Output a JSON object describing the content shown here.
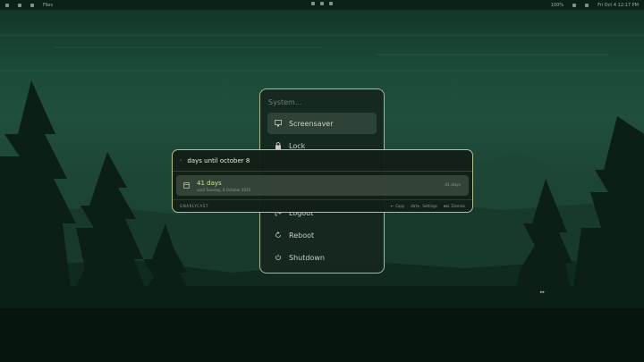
{
  "topbar": {
    "window_label": "Files",
    "clock": "Fri Oct 4  12:17 PM",
    "battery": "100%"
  },
  "system_menu": {
    "search_placeholder": "System...",
    "items": [
      {
        "label": "Screensaver",
        "icon": "monitor-icon",
        "selected": true
      },
      {
        "label": "Lock",
        "icon": "lock-icon",
        "selected": false
      },
      {
        "label": "Logout",
        "icon": "logout-icon",
        "selected": false
      },
      {
        "label": "Reboot",
        "icon": "reboot-icon",
        "selected": false
      },
      {
        "label": "Shutdown",
        "icon": "power-icon",
        "selected": false
      }
    ]
  },
  "raycast": {
    "query": "days until october 8",
    "result": {
      "title": "41 days",
      "subtitle": "until Tuesday, 8 October 2025",
      "accessory": "41 days"
    },
    "footer": {
      "brand": "GNARLYCAST",
      "copy_key": "↵",
      "copy_label": "Copy",
      "settings_key": "ctrl+,",
      "settings_label": "Settings",
      "dismiss_key": "esc",
      "dismiss_label": "Dismiss"
    }
  },
  "colors": {
    "accent": "#cfe39c",
    "panel_border": "#b3c293",
    "panel_bg": "#121f18"
  }
}
